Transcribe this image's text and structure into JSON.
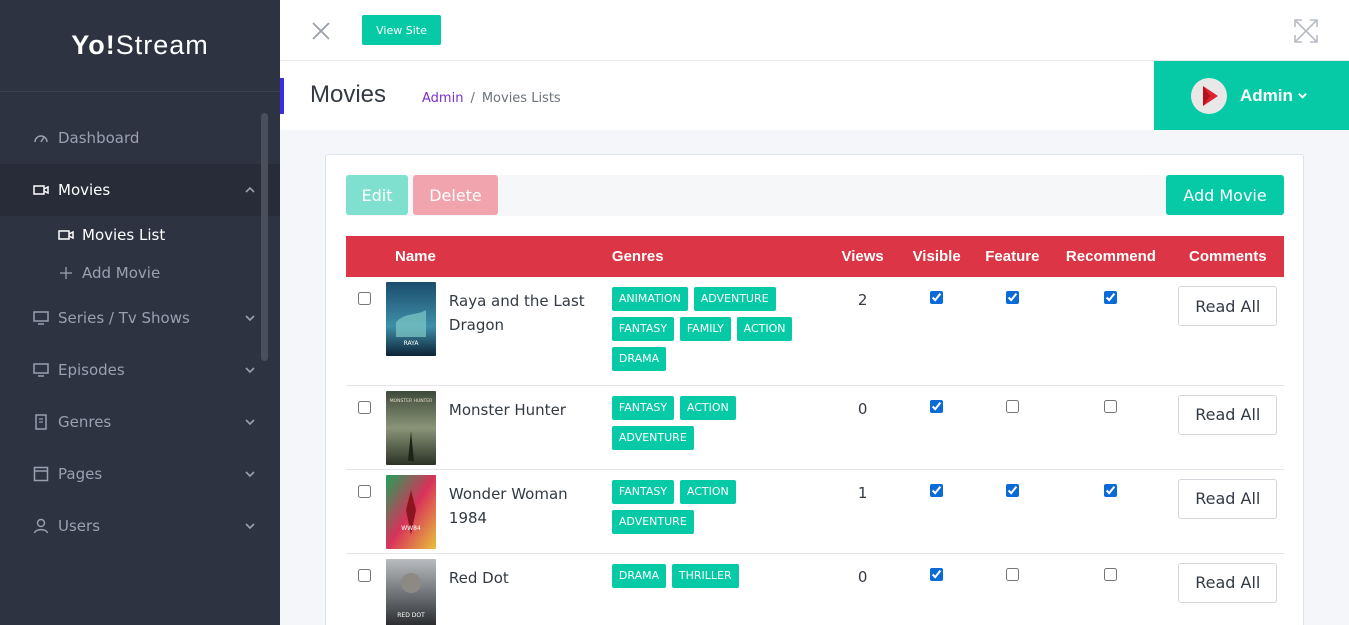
{
  "brand": {
    "bold": "Yo!",
    "rest": "Stream"
  },
  "sidebar": {
    "items": [
      {
        "label": "Dashboard",
        "icon": "dashboard-icon"
      },
      {
        "label": "Movies",
        "icon": "video-camera-icon"
      },
      {
        "label": "Series / Tv Shows",
        "icon": "tv-icon"
      },
      {
        "label": "Episodes",
        "icon": "tv-icon"
      },
      {
        "label": "Genres",
        "icon": "book-icon"
      },
      {
        "label": "Pages",
        "icon": "page-icon"
      },
      {
        "label": "Users",
        "icon": "user-icon"
      }
    ],
    "sub_items": [
      {
        "label": "Movies List",
        "icon": "video-camera-icon"
      },
      {
        "label": "Add Movie",
        "icon": "plus-icon"
      }
    ]
  },
  "topbar": {
    "view_site_label": "View Site"
  },
  "header": {
    "title": "Movies",
    "breadcrumb": [
      "Admin",
      "Movies Lists"
    ],
    "user_name": "Admin"
  },
  "toolbar": {
    "edit_label": "Edit",
    "delete_label": "Delete",
    "add_label": "Add Movie"
  },
  "table": {
    "columns": [
      "Name",
      "Genres",
      "Views",
      "Visible",
      "Feature",
      "Recommend",
      "Comments"
    ],
    "rows": [
      {
        "name": "Raya and the Last Dragon",
        "genres": [
          "ANIMATION",
          "ADVENTURE",
          "FANTASY",
          "FAMILY",
          "ACTION",
          "DRAMA"
        ],
        "views": "2",
        "visible": true,
        "feature": true,
        "recommend": true,
        "comments_label": "Read All",
        "poster_text": "RAYA"
      },
      {
        "name": "Monster Hunter",
        "genres": [
          "FANTASY",
          "ACTION",
          "ADVENTURE"
        ],
        "views": "0",
        "visible": true,
        "feature": false,
        "recommend": false,
        "comments_label": "Read All",
        "poster_text": "MONSTER HUNTER"
      },
      {
        "name": "Wonder Woman 1984",
        "genres": [
          "FANTASY",
          "ACTION",
          "ADVENTURE"
        ],
        "views": "1",
        "visible": true,
        "feature": true,
        "recommend": true,
        "comments_label": "Read All",
        "poster_text": "WW84"
      },
      {
        "name": "Red Dot",
        "genres": [
          "DRAMA",
          "THRILLER"
        ],
        "views": "0",
        "visible": true,
        "feature": false,
        "recommend": false,
        "comments_label": "Read All",
        "poster_text": "RED DOT"
      }
    ]
  },
  "colors": {
    "accent": "#06c9a6",
    "table_header": "#dc3545",
    "sidebar_bg": "#2e3341",
    "breadcrumb_link": "#7b2fd1"
  }
}
